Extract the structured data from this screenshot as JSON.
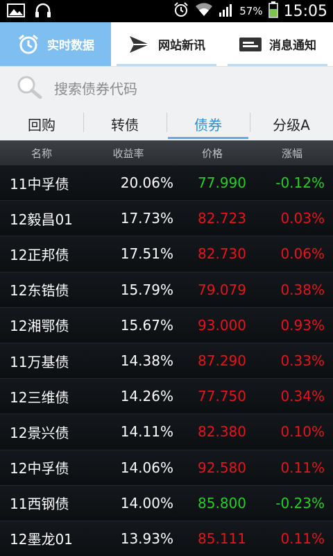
{
  "status_bar": {
    "battery_pct": "57%",
    "time": "15:05"
  },
  "top_tabs": [
    {
      "label": "实时数据",
      "icon": "alarm-clock-icon",
      "active": true
    },
    {
      "label": "网站新讯",
      "icon": "send-icon",
      "active": false
    },
    {
      "label": "消息通知",
      "icon": "message-icon",
      "active": false
    }
  ],
  "search": {
    "placeholder": "搜索债券代码"
  },
  "category_tabs": [
    {
      "label": "回购",
      "active": false
    },
    {
      "label": "转债",
      "active": false
    },
    {
      "label": "债券",
      "active": true
    },
    {
      "label": "分级A",
      "active": false
    }
  ],
  "table": {
    "headers": [
      "名称",
      "收益率",
      "价格",
      "涨幅"
    ],
    "rows": [
      {
        "name": "11中孚债",
        "yield": "20.06%",
        "price": "77.990",
        "change": "-0.12%",
        "dir": "down"
      },
      {
        "name": "12毅昌01",
        "yield": "17.73%",
        "price": "82.723",
        "change": "0.03%",
        "dir": "up"
      },
      {
        "name": "12正邦债",
        "yield": "17.51%",
        "price": "82.730",
        "change": "0.06%",
        "dir": "up"
      },
      {
        "name": "12东锆债",
        "yield": "15.79%",
        "price": "79.079",
        "change": "0.38%",
        "dir": "up"
      },
      {
        "name": "12湘鄂债",
        "yield": "15.67%",
        "price": "93.000",
        "change": "0.93%",
        "dir": "up"
      },
      {
        "name": "11万基债",
        "yield": "14.38%",
        "price": "87.290",
        "change": "0.33%",
        "dir": "up"
      },
      {
        "name": "12三维债",
        "yield": "14.26%",
        "price": "77.750",
        "change": "0.34%",
        "dir": "up"
      },
      {
        "name": "12景兴债",
        "yield": "14.11%",
        "price": "82.380",
        "change": "0.10%",
        "dir": "up"
      },
      {
        "name": "12中孚债",
        "yield": "14.06%",
        "price": "92.580",
        "change": "0.11%",
        "dir": "up"
      },
      {
        "name": "11西钢债",
        "yield": "14.00%",
        "price": "85.800",
        "change": "-0.23%",
        "dir": "down"
      },
      {
        "name": "12墨龙01",
        "yield": "13.93%",
        "price": "85.111",
        "change": "0.11%",
        "dir": "up"
      }
    ]
  },
  "colors": {
    "up": "#e8141b",
    "down": "#23d122",
    "accent": "#7fbef0"
  }
}
